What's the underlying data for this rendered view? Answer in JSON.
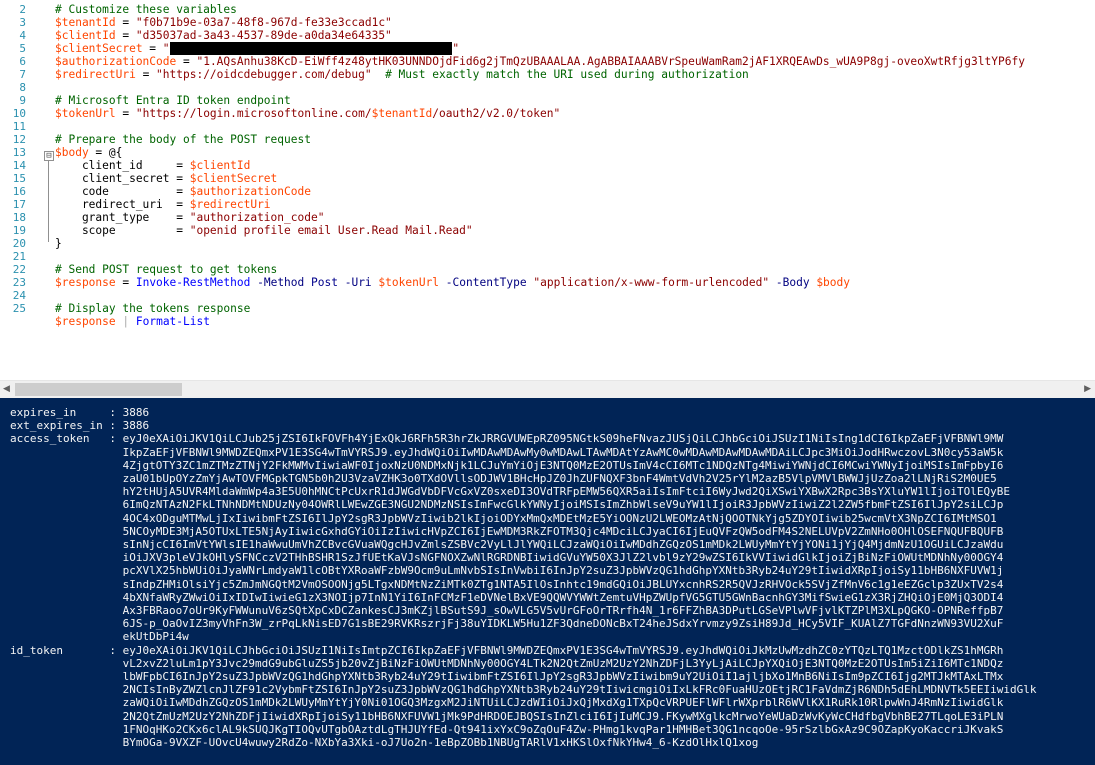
{
  "editor": {
    "line_numbers": [
      "2",
      "3",
      "4",
      "5",
      "6",
      "7",
      "8",
      "9",
      "10",
      "11",
      "12",
      "13",
      "14",
      "15",
      "16",
      "17",
      "18",
      "19",
      "20",
      "21",
      "22",
      "23",
      "24",
      "25"
    ],
    "fold_toggle": "⊟",
    "lines": [
      [
        {
          "c": "t-comment",
          "t": "# Customize these variables"
        }
      ],
      [
        {
          "c": "t-var",
          "t": "$tenantId"
        },
        {
          "c": "t-plain",
          "t": " = "
        },
        {
          "c": "t-string",
          "t": "\"f0b71b9e-03a7-48f8-967d-fe33e3ccad1c\""
        }
      ],
      [
        {
          "c": "t-var",
          "t": "$clientId"
        },
        {
          "c": "t-plain",
          "t": " = "
        },
        {
          "c": "t-string",
          "t": "\"d35037ad-3a43-4537-89de-a0da34e64335\""
        }
      ],
      [
        {
          "c": "t-var",
          "t": "$clientSecret"
        },
        {
          "c": "t-plain",
          "t": " = "
        },
        {
          "c": "t-string",
          "t": "\""
        },
        {
          "c": "t-redact",
          "t": "                                          "
        },
        {
          "c": "t-string",
          "t": "\""
        }
      ],
      [
        {
          "c": "t-var",
          "t": "$authorizationCode"
        },
        {
          "c": "t-plain",
          "t": " = "
        },
        {
          "c": "t-string",
          "t": "\"1.AQsAnhu38KcD-EiWff4z48ytHK03UNNDOjdFid6g2jTmQzUBAAALAA.AgABBAIAAABVrSpeuWamRam2jAF1XRQEAwDs_wUA9P8gj-oveoXwtRfjg3ltYP6fy"
        }
      ],
      [
        {
          "c": "t-var",
          "t": "$redirectUri"
        },
        {
          "c": "t-plain",
          "t": " = "
        },
        {
          "c": "t-string",
          "t": "\"https://oidcdebugger.com/debug\""
        },
        {
          "c": "t-plain",
          "t": "  "
        },
        {
          "c": "t-comment",
          "t": "# Must exactly match the URI used during authorization"
        }
      ],
      [],
      [
        {
          "c": "t-comment",
          "t": "# Microsoft Entra ID token endpoint"
        }
      ],
      [
        {
          "c": "t-var",
          "t": "$tokenUrl"
        },
        {
          "c": "t-plain",
          "t": " = "
        },
        {
          "c": "t-string",
          "t": "\"https://login.microsoftonline.com/"
        },
        {
          "c": "t-var",
          "t": "$tenantId"
        },
        {
          "c": "t-string",
          "t": "/oauth2/v2.0/token\""
        }
      ],
      [],
      [
        {
          "c": "t-comment",
          "t": "# Prepare the body of the POST request"
        }
      ],
      [
        {
          "c": "t-var",
          "t": "$body"
        },
        {
          "c": "t-plain",
          "t": " = @{"
        }
      ],
      [
        {
          "c": "t-plain",
          "t": "    client_id     = "
        },
        {
          "c": "t-var",
          "t": "$clientId"
        }
      ],
      [
        {
          "c": "t-plain",
          "t": "    client_secret = "
        },
        {
          "c": "t-var",
          "t": "$clientSecret"
        }
      ],
      [
        {
          "c": "t-plain",
          "t": "    code          = "
        },
        {
          "c": "t-var",
          "t": "$authorizationCode"
        }
      ],
      [
        {
          "c": "t-plain",
          "t": "    redirect_uri  = "
        },
        {
          "c": "t-var",
          "t": "$redirectUri"
        }
      ],
      [
        {
          "c": "t-plain",
          "t": "    grant_type    = "
        },
        {
          "c": "t-string",
          "t": "\"authorization_code\""
        }
      ],
      [
        {
          "c": "t-plain",
          "t": "    scope         = "
        },
        {
          "c": "t-string",
          "t": "\"openid profile email User.Read Mail.Read\""
        }
      ],
      [
        {
          "c": "t-plain",
          "t": "}"
        }
      ],
      [],
      [
        {
          "c": "t-comment",
          "t": "# Send POST request to get tokens"
        }
      ],
      [
        {
          "c": "t-var",
          "t": "$response"
        },
        {
          "c": "t-plain",
          "t": " = "
        },
        {
          "c": "t-cmdlet",
          "t": "Invoke-RestMethod"
        },
        {
          "c": "t-plain",
          "t": " "
        },
        {
          "c": "t-param",
          "t": "-Method"
        },
        {
          "c": "t-plain",
          "t": " "
        },
        {
          "c": "t-kw",
          "t": "Post"
        },
        {
          "c": "t-plain",
          "t": " "
        },
        {
          "c": "t-param",
          "t": "-Uri"
        },
        {
          "c": "t-plain",
          "t": " "
        },
        {
          "c": "t-var",
          "t": "$tokenUrl"
        },
        {
          "c": "t-plain",
          "t": " "
        },
        {
          "c": "t-param",
          "t": "-ContentType"
        },
        {
          "c": "t-plain",
          "t": " "
        },
        {
          "c": "t-string",
          "t": "\"application/x-www-form-urlencoded\""
        },
        {
          "c": "t-plain",
          "t": " "
        },
        {
          "c": "t-param",
          "t": "-Body"
        },
        {
          "c": "t-plain",
          "t": " "
        },
        {
          "c": "t-var",
          "t": "$body"
        }
      ],
      [],
      [
        {
          "c": "t-comment",
          "t": "# Display the tokens response"
        }
      ],
      [
        {
          "c": "t-var",
          "t": "$response"
        },
        {
          "c": "t-plain",
          "t": " "
        },
        {
          "c": "t-op",
          "t": "|"
        },
        {
          "c": "t-plain",
          "t": " "
        },
        {
          "c": "t-cmdlet",
          "t": "Format-List"
        }
      ]
    ]
  },
  "scrollbar": {
    "left_arrow": "◀",
    "right_arrow": "▶"
  },
  "console": {
    "lines": [
      "expires_in     : 3886",
      "ext_expires_in : 3886",
      "access_token   : eyJ0eXAiOiJKV1QiLCJub25jZSI6IkFOVFh4YjExQkJ6RFh5R3hrZkJRRGVUWEpRZ095NGtkS09heFNvazJUSjQiLCJhbGciOiJSUzI1NiIsIng1dCI6IkpZaEFjVFBNWl9MW",
      "                 IkpZaEFjVFBNWl9MWDZEQmxPV1E3SG4wTmVYRSJ9.eyJhdWQiOiIwMDAwMDAwMy0wMDAwLTAwMDAtYzAwMC0wMDAwMDAwMDAwMDAiLCJpc3MiOiJodHRwczovL3N0cy53aW5k",
      "                 4ZjgtOTY3ZC1mZTMzZTNjY2FkMWMvIiwiaWF0IjoxNzU0NDMxNjk1LCJuYmYiOjE3NTQ0MzE2OTUsImV4cCI6MTc1NDQzNTg4MiwiYWNjdCI6MCwiYWNyIjoiMSIsImFpbyI6",
      "                 zaU01bUpOYzZmYjAwTOVFMGpkTGN5b0h2U3VzaVZHK3o0TXdOVllsODJWV1BHcHpJZ0JhZUFNQXF3bnF4WmtVdVh2V25rYlM2azB5VlpVMVlBWWJjUzZoa2lLNjRiS2M0UE5",
      "                 hY2tHUjA5UVR4MldaWmWp4a3E5U0hMNCtPcUxrR1dJWGdVbDFVcGxVZ0sxeDI3OVdTRFpEMW56QXR5aiIsImFtciI6WyJwd2QiXSwiYXBwX2Rpc3BsYXluYW1lIjoiTOlEQyBE",
      "                 6ImQzNTAzN2FkLTNhNDMtNDUzNy04OWRlLWEwZGE3NGU2NDMzNSIsImFwcGlkYWNyIjoiMSIsImZhbWlseV9uYW1lIjoiR3JpbWVzIiwiZ2l2ZW5fbmFtZSI6IlJpY2siLCJp",
      "                 4OC4xODguMTMwLjIxIiwibmFtZSI6IlJpY2sgR3JpbWVzIiwib2lkIjoiODYxMmQxMDEtMzE5YiOONzU2LWEOMzAtNjQOOTNkYjg5ZDYOIiwib25wcmVtX3NpZCI6IMtMSO1",
      "                 5NCOyMDE3MjA5OTUxLTE5NjAyIiwicGxhdGYiOiIzIiwicHVpZCI6IjEwMDM3RkZFOTM3Qjc4MDciLCJyaCI6IjEuQVFzQW5odFM4S2NELUVpV2ZmNHo0OHlOSEFNQUFBQUFB",
      "                 sInNjcCI6ImVtYWlsIE1haWwuUmVhZCBvcGVuaWQgcHJvZmlsZSBVc2VyLlJlYWQiLCJzaWQiOiIwMDdhZGQzOS1mMDk2LWUyMmYtYjYONi1jYjQ4MjdmNzU1OGUiLCJzaWdu",
      "                 iOiJXV3pleVJkOHlySFNCczV2THhBSHR1SzJfUEtKaVJsNGFNOXZwNlRGRDNBIiwidGVuYW50X3JlZ2lvbl9zY29wZSI6IkVVIiwidGlkIjoiZjBiNzFiOWUtMDNhNy00OGY4",
      "                 pcXVlX25hbWUiOiJyaWNrLmdyaW1lcOBtYXRoaWFzbW9Ocm9uLmNvbSIsInVwbiI6InJpY2suZ3JpbWVzQG1hdGhpYXNtb3Ryb24uY29tIiwidXRpIjoiSy11bHB6NXFUVW1j",
      "                 sIndpZHMiOlsiYjc5ZmJmNGQtM2VmOSOONjg5LTgxNDMtNzZiMTk0ZTg1NTA5IlOsInhtc19mdGQiOiJBLUYxcnhRS2R5QVJzRHVOck5SVjZfMnV6c1g1eEZGclp3ZUxTV2s4",
      "                 4bXNfaWRyZWwiOiIxIDIwIiwieG1zX3NOIjp7InN1YiI6InFCMzF1eDVNelBxVE9QQWVYWWtZemtuVHpZWUpfVG5GTU5GWnBacnhGY3MifSwieG1zX3RjZHQiOjE0MjQ3ODI4",
      "                 Ax3FBRaoo7oUr9KyFWWunuV6zSQtXpCxDCZankesCJ3mKZjlBSutS9J_sOwVLG5V5vUrGFoOrTRrfh4N_1r6FFZhBA3DPutLGSeVPlwVFjvlKTZPlM3XLpQGKO-OPNReffpB7",
      "                 6JS-p_OaOvIZ3myVhFn3W_zrPqLkNisED7G1sBE29RVKRszrjFj38uYIDKLW5Hu1ZF3QdneDONcBxT24heJSdxYrvmzy9ZsiH89Jd_HCy5VIF_KUAlZ7TGFdNnzWN93VU2XuF",
      "                 ekUtDbPi4w",
      "id_token       : eyJ0eXAiOiJKV1QiLCJhbGciOiJSUzI1NiIsImtpZCI6IkpZaEFjVFBNWl9MWDZEQmxPV1E3SG4wTmVYRSJ9.eyJhdWQiOiJkMzUwMzdhZC0zYTQzLTQ1MzctODlkZS1hMGRh",
      "                 vL2xvZ2luLm1pY3Jvc29mdG9ubGluZS5jb20vZjBiNzFiOWUtMDNhNy00OGY4LTk2N2QtZmUzM2UzY2NhZDFjL3YyLjAiLCJpYXQiOjE3NTQ0MzE2OTUsIm5iZiI6MTc1NDQz",
      "                 lbWFpbCI6InJpY2suZ3JpbWVzQG1hdGhpYXNtb3Ryb24uY29tIiwibmFtZSI6IlJpY2sgR3JpbWVzIiwibm9uY2UiOiI1ajljbXo1MnB6NiIsIm9pZCI6Ijg2MTJkMTAxLTMx",
      "                 2NCIsInByZWZlcnJlZF91c2VybmFtZSI6InJpY2suZ3JpbWVzQG1hdGhpYXNtb3Ryb24uY29tIiwicmgiOiIxLkFRc0FuaHUzOEtjRC1FaVdmZjR6NDh5dEhLMDNVTk5EEIiwidGlk",
      "                 zaWQiOiIwMDdhZGQzOS1mMDk2LWUyMmYtYjY0Ni01OGQ3MzgxM2JiNTUiLCJzdWIiOiJxQjMxdXg1TXpQcVRPUEFlWFlrWXprblR6WVlKX1RuRk10RlpwWnJ4RmNzIiwidGlk",
      "                 2N2QtZmUzM2UzY2NhZDFjIiwidXRpIjoiSy11bHB6NXFUVW1jMk9PdHRDOEJBQSIsInZlciI6IjIuMCJ9.FKywMXglkcMrwoYeWUaDzWvKyWcCHdfbgVbhBE27TLqoLE3iPLN",
      "                 1FNOqHKo2CKx6clAL9kSUQJKgTIOQvUTgbOAztdLgTHJUYfEd-Qt941ixYxC9oZqOuF4Zw-PHmg1kvqPar1HMHBet3QG1ncqoOe-95rSzlbGxAz9C9OZapKyoKaccriJKvakS",
      "                 BYmOGa-9VXZF-UOvcU4wuwy2RdZo-NXbYa3Xki-oJ7Uo2n-1eBpZOBb1NBUgTARlV1xHKSlOxfNkYHw4_6-KzdOlHxlQ1xog"
    ]
  }
}
